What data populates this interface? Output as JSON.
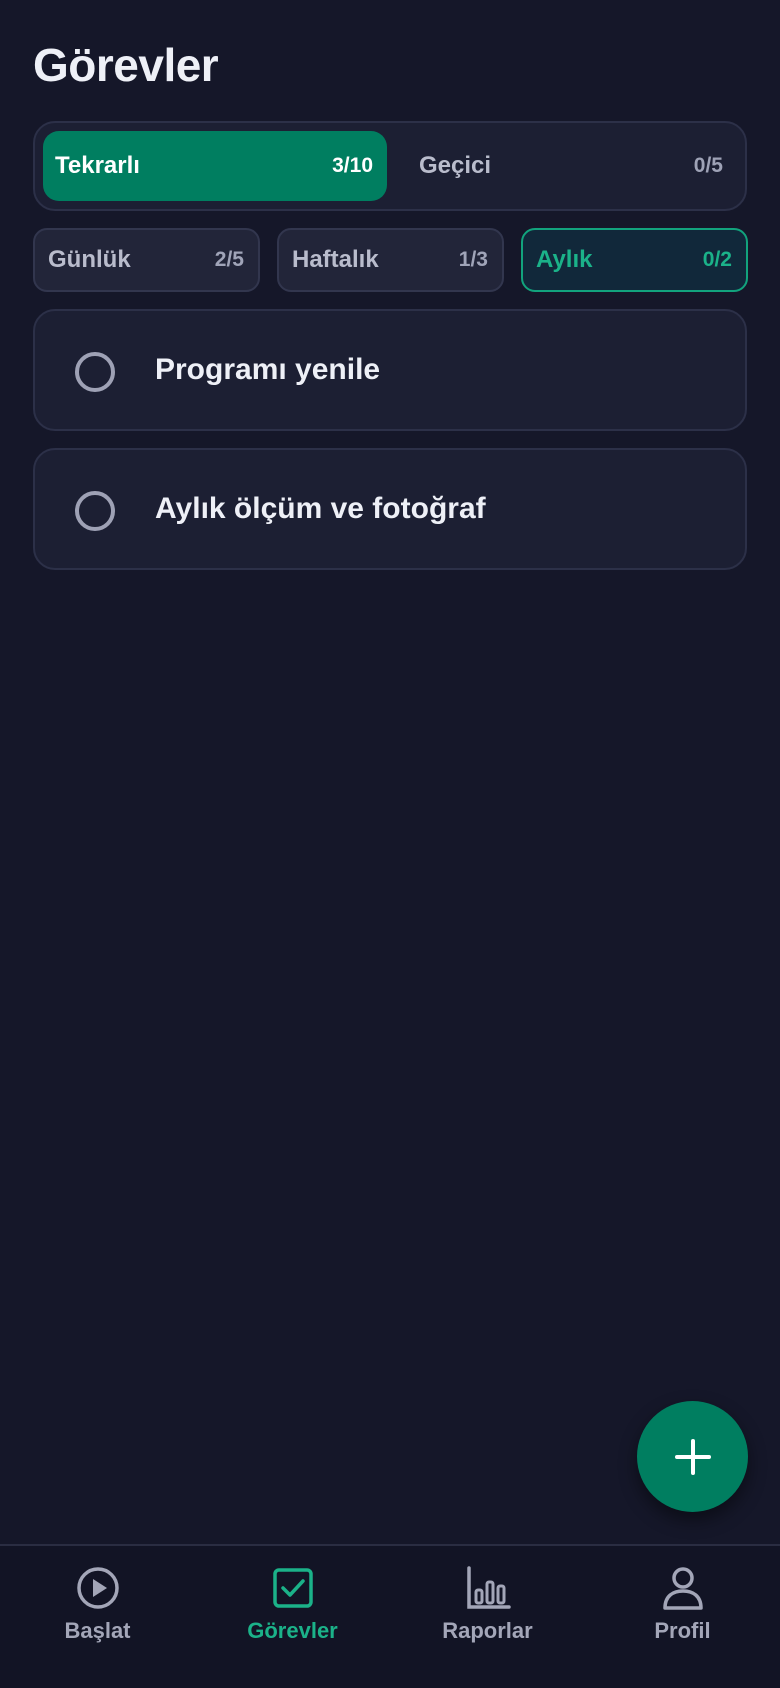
{
  "page": {
    "title": "Görevler"
  },
  "segment": {
    "items": [
      {
        "label": "Tekrarlı",
        "count": "3/10",
        "active": true
      },
      {
        "label": "Geçici",
        "count": "0/5",
        "active": false
      }
    ]
  },
  "periods": [
    {
      "label": "Günlük",
      "count": "2/5",
      "active": false
    },
    {
      "label": "Haftalık",
      "count": "1/3",
      "active": false
    },
    {
      "label": "Aylık",
      "count": "0/2",
      "active": true
    }
  ],
  "tasks": [
    {
      "title": "Programı yenile",
      "done": false
    },
    {
      "title": "Aylık ölçüm ve fotoğraf",
      "done": false
    }
  ],
  "fab": {
    "icon": "plus-icon"
  },
  "tabbar": {
    "items": [
      {
        "label": "Başlat",
        "icon": "play-circle-icon",
        "active": false
      },
      {
        "label": "Görevler",
        "icon": "checkbox-icon",
        "active": true
      },
      {
        "label": "Raporlar",
        "icon": "bar-chart-icon",
        "active": false
      },
      {
        "label": "Profil",
        "icon": "user-icon",
        "active": false
      }
    ]
  },
  "colors": {
    "background": "#151729",
    "accent": "#007e60",
    "accent_text": "#1bb289",
    "card": "#1c1f33",
    "muted_text": "#a3a6b8"
  }
}
